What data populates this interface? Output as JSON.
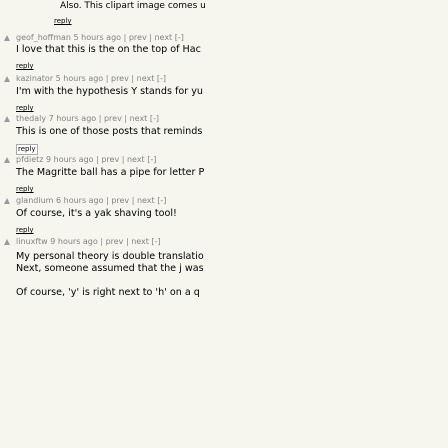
{
  "top_fragment": {
    "text": "Also. This clipart image comes u",
    "reply_label": "reply"
  },
  "comments": [
    {
      "user": "geof_hoffman",
      "age": "5 hours ago",
      "nav": "| prev | next [-]",
      "text": [
        "I love that this is the on the top of Hac"
      ],
      "reply_label": "reply"
    },
    {
      "user": "kazinator",
      "age": "5 hours ago",
      "nav": "| prev | next [-]",
      "text": [
        "I'm with the hypothesis Y stands for yu"
      ],
      "reply_label": "reply"
    },
    {
      "user": "thedaly",
      "age": "7 hours ago",
      "nav": "| prev | next [-]",
      "text": [
        "This is one of those posts that reminds"
      ],
      "reply_label": "reply"
    },
    {
      "user": "pfdietz",
      "age": "9 hours ago",
      "nav": "| prev | next [-]",
      "text": [
        "The Magritte ball has a pipe for letter P"
      ],
      "reply_label": "reply"
    },
    {
      "user": "glandium",
      "age": "6 hours ago",
      "nav": "| prev | next [-]",
      "text": [
        "Of course, it's a yak shaving tool!"
      ],
      "reply_label": "reply"
    },
    {
      "user": "linuxftw",
      "age": "9 hours ago",
      "nav": "| prev | next [-]",
      "text": [
        "My personal theory is double translatio",
        "Next, someone assumed that the j was",
        "Of course, 'y' is right next to 'h' on a q"
      ],
      "reply_label": ""
    }
  ]
}
